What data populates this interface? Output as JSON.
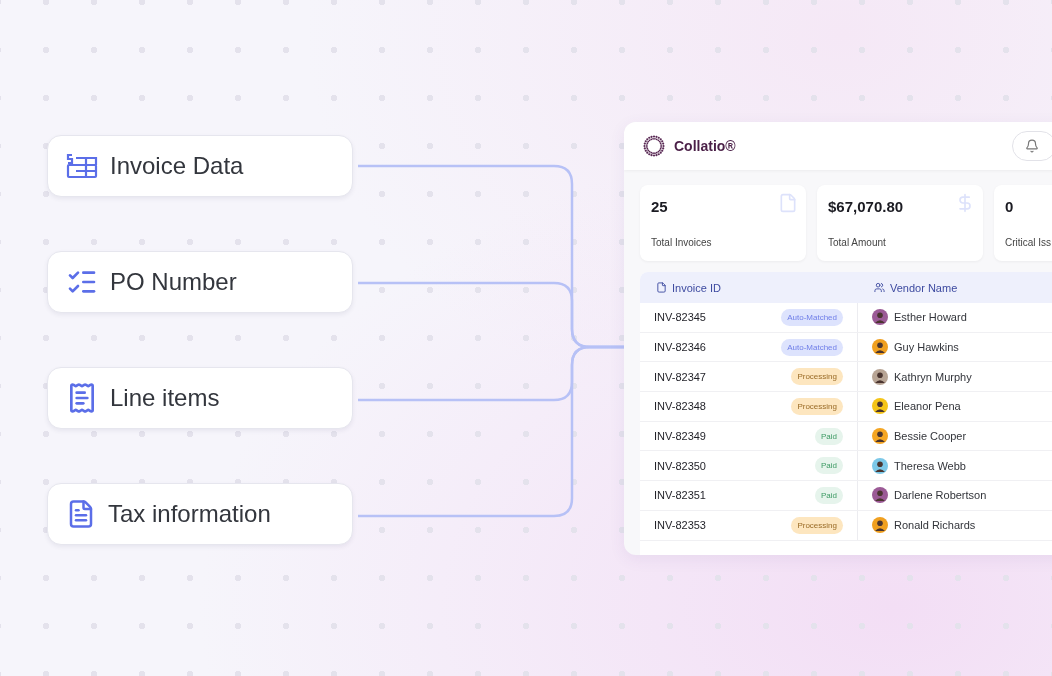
{
  "fields": [
    {
      "label": "Invoice Data"
    },
    {
      "label": "PO Number"
    },
    {
      "label": "Line items"
    },
    {
      "label": "Tax information"
    }
  ],
  "dashboard": {
    "brand": "Collatio®",
    "stats": [
      {
        "value": "25",
        "label": "Total Invoices"
      },
      {
        "value": "$67,070.80",
        "label": "Total Amount"
      },
      {
        "value": "0",
        "label": "Critical Iss"
      }
    ],
    "table": {
      "columns": [
        "Invoice ID",
        "Vendor Name"
      ],
      "rows": [
        {
          "invoice_id": "INV-82345",
          "status": "Auto-Matched",
          "kind": "auto",
          "vendor": "Esther Howard",
          "color": "#9b5a96"
        },
        {
          "invoice_id": "INV-82346",
          "status": "Auto-Matched",
          "kind": "auto",
          "vendor": "Guy Hawkins",
          "color": "#f0a020"
        },
        {
          "invoice_id": "INV-82347",
          "status": "Processing",
          "kind": "processing",
          "vendor": "Kathryn Murphy",
          "color": "#b8a595"
        },
        {
          "invoice_id": "INV-82348",
          "status": "Processing",
          "kind": "processing",
          "vendor": "Eleanor Pena",
          "color": "#f5c518"
        },
        {
          "invoice_id": "INV-82349",
          "status": "Paid",
          "kind": "paid",
          "vendor": "Bessie Cooper",
          "color": "#f5a623"
        },
        {
          "invoice_id": "INV-82350",
          "status": "Paid",
          "kind": "paid",
          "vendor": "Theresa Webb",
          "color": "#7cc8e8"
        },
        {
          "invoice_id": "INV-82351",
          "status": "Paid",
          "kind": "paid",
          "vendor": "Darlene Robertson",
          "color": "#9b5a96"
        },
        {
          "invoice_id": "INV-82353",
          "status": "Processing",
          "kind": "processing",
          "vendor": "Ronald Richards",
          "color": "#f0a020"
        }
      ]
    }
  }
}
